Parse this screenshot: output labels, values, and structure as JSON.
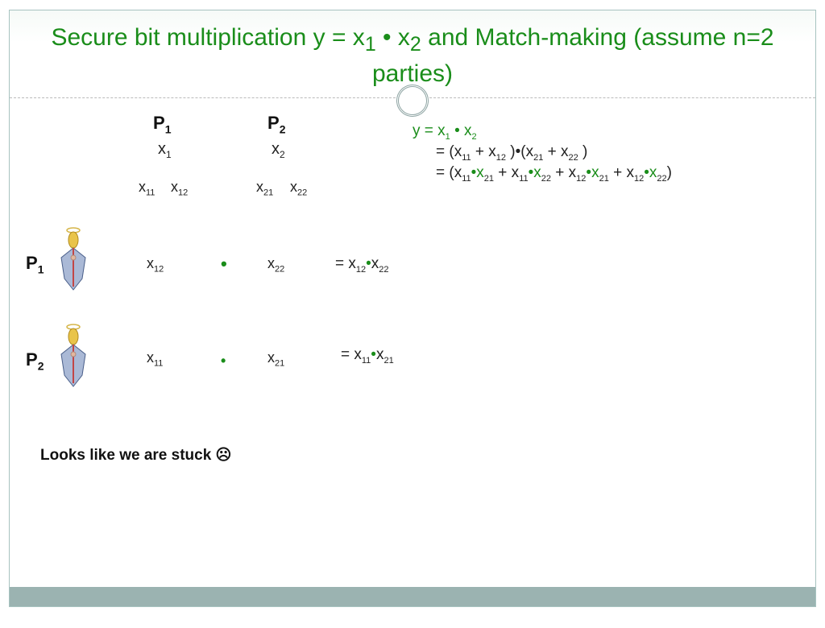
{
  "title": {
    "prefix": "Secure bit multiplication y = x",
    "s1": "1",
    "mid": " • x",
    "s2": "2",
    "suffix": " and Match-making (assume n=2 parties)"
  },
  "headers": {
    "P1": "P",
    "P1s": "1",
    "P2": "P",
    "P2s": "2",
    "x1": "x",
    "x1s": "1",
    "x2": "x",
    "x2s": "2",
    "x11": "x",
    "x11s": "11",
    "x12": "x",
    "x12s": "12",
    "x21": "x",
    "x21s": "21",
    "x22": "x",
    "x22s": "22"
  },
  "rows": {
    "P1label": "P",
    "P1s": "1",
    "P2label": "P",
    "P2s": "2",
    "r1a": "x",
    "r1as": "12",
    "r1b": "x",
    "r1bs": "22",
    "r1eq_pre": "= x",
    "r1eq_dot": "•",
    "r1eq_post": "x",
    "r1eq_s1": "12",
    "r1eq_s2": "22",
    "r2a": "x",
    "r2as": "11",
    "r2b": "x",
    "r2bs": "21",
    "r2eq_pre": "= x",
    "r2eq_dot": "•",
    "r2eq_post": "x",
    "r2eq_s1": "11",
    "r2eq_s2": "21",
    "dot": "•"
  },
  "derivation": {
    "line1_a": "y = x",
    "line1_s1": "1",
    "line1_b": "• x",
    "line1_s2": "2",
    "line2": "= (x",
    "l2s1": "11",
    "l2a": " + x",
    "l2s2": "12",
    "l2b": " )•(x",
    "l2s3": "21",
    "l2c": " + x",
    "l2s4": "22",
    "l2d": " )",
    "line3": "= (x",
    "l3s1": "11",
    "l3a": "•x",
    "l3s2": "21",
    "l3b": " + x",
    "l3s3": "11",
    "l3c": "•x",
    "l3s4": "22",
    "l3d": " + x",
    "l3s5": "12",
    "l3e": "•x",
    "l3s6": "21",
    "l3f": " + x",
    "l3s7": "12",
    "l3g": "•x",
    "l3s8": "22",
    "l3h": ")"
  },
  "stuck": "Looks like we are stuck ☹"
}
